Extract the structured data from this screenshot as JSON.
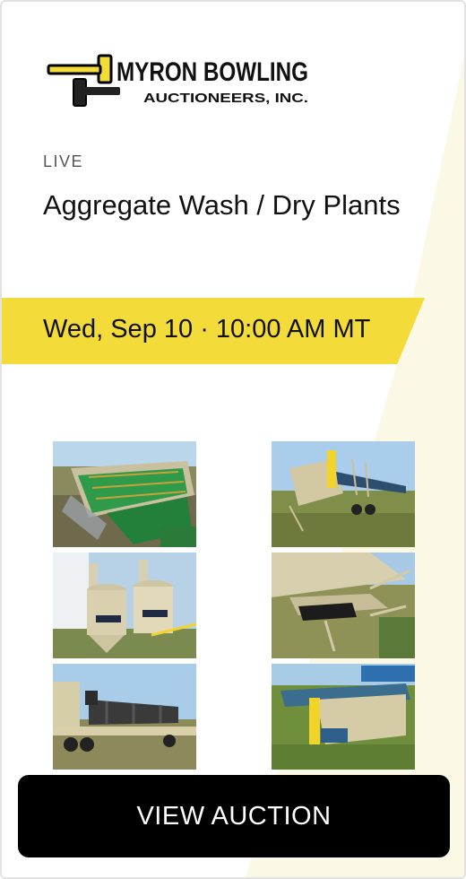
{
  "brand": {
    "name": "MYRON BOWLING",
    "subtitle": "AUCTIONEERS, INC.",
    "colors": {
      "yellow": "#f3dc3a",
      "black": "#000000",
      "cream": "#fcf8e6"
    }
  },
  "auction": {
    "status": "LIVE",
    "title": "Aggregate Wash / Dry Plants",
    "date": "Wed, Sep 10 · 10:00 AM MT"
  },
  "photos": [
    {
      "name": "green-screen-deck-photo"
    },
    {
      "name": "conveyor-hopper-photo"
    },
    {
      "name": "superior-wash-tanks-photo"
    },
    {
      "name": "conveyor-belt-closeup-photo"
    },
    {
      "name": "rotary-dryer-trailer-photo"
    },
    {
      "name": "feeder-hopper-photo"
    }
  ],
  "cta": {
    "label": "VIEW AUCTION"
  }
}
